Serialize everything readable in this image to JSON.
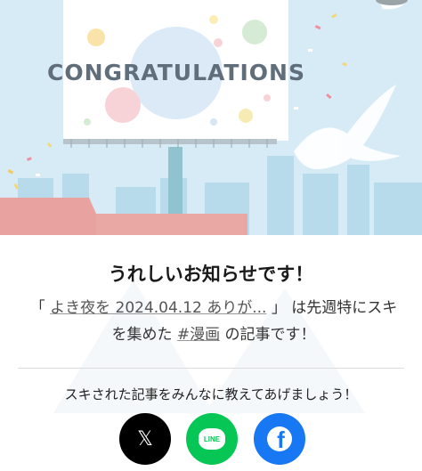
{
  "banner": {
    "sign_text": "CONGRATULATIONS"
  },
  "headline": "うれしいお知らせです！",
  "message": {
    "open_quote": "「",
    "article_link": "よき夜を 2024.04.12 ありが...",
    "close_quote": "」",
    "text_after_quote": "は先週特にスキを集めた",
    "hashtag": "#漫画",
    "text_end": "の記事です！"
  },
  "share": {
    "prompt": "スキされた記事をみんなに教えてあげましょう！",
    "x_glyph": "𝕏",
    "line_glyph": "LINE",
    "facebook_glyph": "f",
    "colors": {
      "x": "#000000",
      "line": "#06c755",
      "facebook": "#1877f2"
    }
  },
  "colors": {
    "sky": "#d6ebf5",
    "billboard_text": "#5f6e7a",
    "brick": "#e8a3a0"
  }
}
